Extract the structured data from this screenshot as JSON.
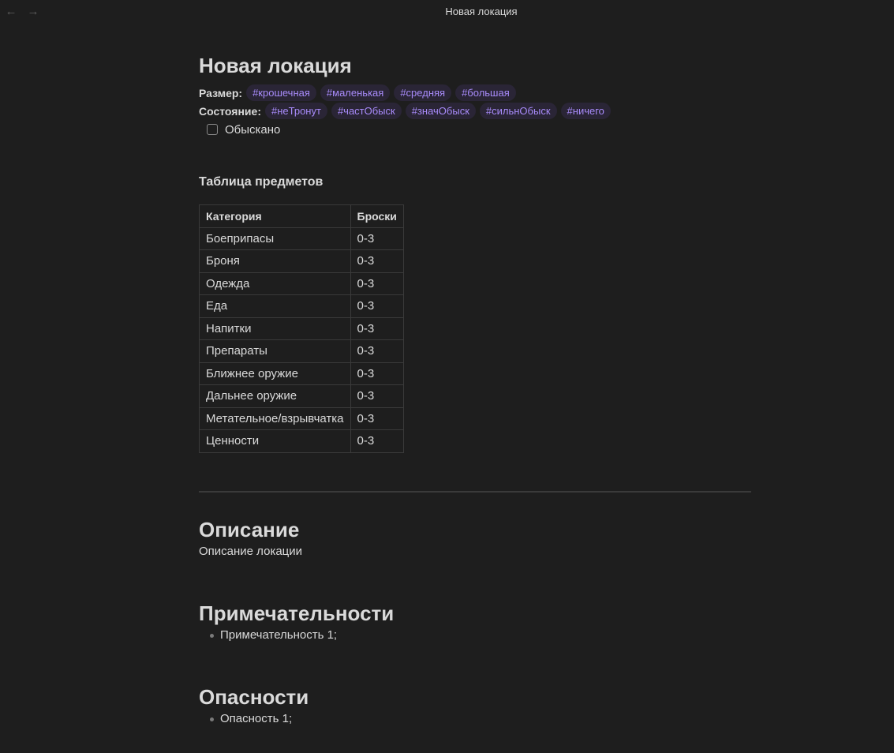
{
  "window": {
    "title": "Новая локация",
    "back_icon": "←",
    "forward_icon": "→"
  },
  "note": {
    "title": "Новая локация",
    "properties": [
      {
        "label": "Размер:",
        "tags": [
          "#крошечная",
          "#маленькая",
          "#средняя",
          "#большая"
        ]
      },
      {
        "label": "Состояние:",
        "tags": [
          "#неТронут",
          "#частОбыск",
          "#значОбыск",
          "#сильнОбыск",
          "#ничего"
        ]
      }
    ],
    "checkbox": {
      "label": "Обыскано",
      "checked": false
    },
    "table_heading": "Таблица предметов",
    "table": {
      "headers": [
        "Категория",
        "Броски"
      ],
      "rows": [
        [
          "Боеприпасы",
          "0-3"
        ],
        [
          "Броня",
          "0-3"
        ],
        [
          "Одежда",
          "0-3"
        ],
        [
          "Еда",
          "0-3"
        ],
        [
          "Напитки",
          "0-3"
        ],
        [
          "Препараты",
          "0-3"
        ],
        [
          "Ближнее оружие",
          "0-3"
        ],
        [
          "Дальнее оружие",
          "0-3"
        ],
        [
          "Метательное/взрывчатка",
          "0-3"
        ],
        [
          "Ценности",
          "0-3"
        ]
      ]
    },
    "sections": {
      "description": {
        "title": "Описание",
        "text": "Описание локации"
      },
      "features": {
        "title": "Примечательности",
        "items": [
          "Примечательность 1;"
        ]
      },
      "dangers": {
        "title": "Опасности",
        "items": [
          "Опасность 1;"
        ]
      }
    }
  },
  "colors": {
    "background": "#1e1e1e",
    "tag_bg": "#2a2536",
    "tag_text": "#a88bfa"
  }
}
